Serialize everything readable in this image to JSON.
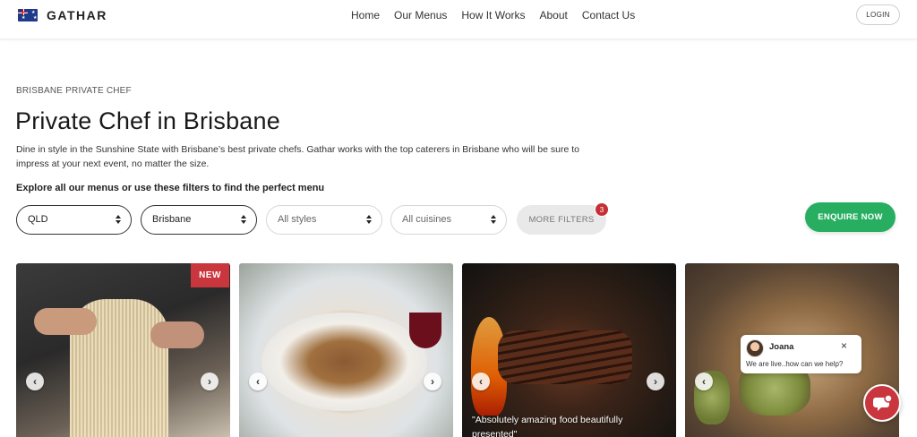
{
  "header": {
    "brand": "GATHAR",
    "nav": [
      "Home",
      "Our Menus",
      "How It Works",
      "About",
      "Contact Us"
    ],
    "login_label": "LOGIN"
  },
  "main": {
    "eyebrow": "BRISBANE PRIVATE CHEF",
    "title": "Private Chef in Brisbane",
    "description": "Dine in style in the Sunshine State with Brisbane’s best private chefs. Gathar works with the top caterers in Brisbane who will be sure to impress at your next event, no matter the size.",
    "explore": "Explore all our menus or use these filters to find the perfect menu"
  },
  "filters": {
    "state": "QLD",
    "city": "Brisbane",
    "styles": "All styles",
    "cuisines": "All cuisines",
    "more_label": "MORE FILTERS",
    "more_count": "3"
  },
  "enquire_label": "ENQUIRE NOW",
  "cards": {
    "new_label": "NEW",
    "quote": "\"Absolutely amazing food beautifully presented\""
  },
  "chat": {
    "agent_name": "Joana",
    "close_symbol": "×",
    "message": "We are live..how can we help?"
  },
  "colors": {
    "accent_green": "#27ae60",
    "accent_red": "#c9363d"
  }
}
